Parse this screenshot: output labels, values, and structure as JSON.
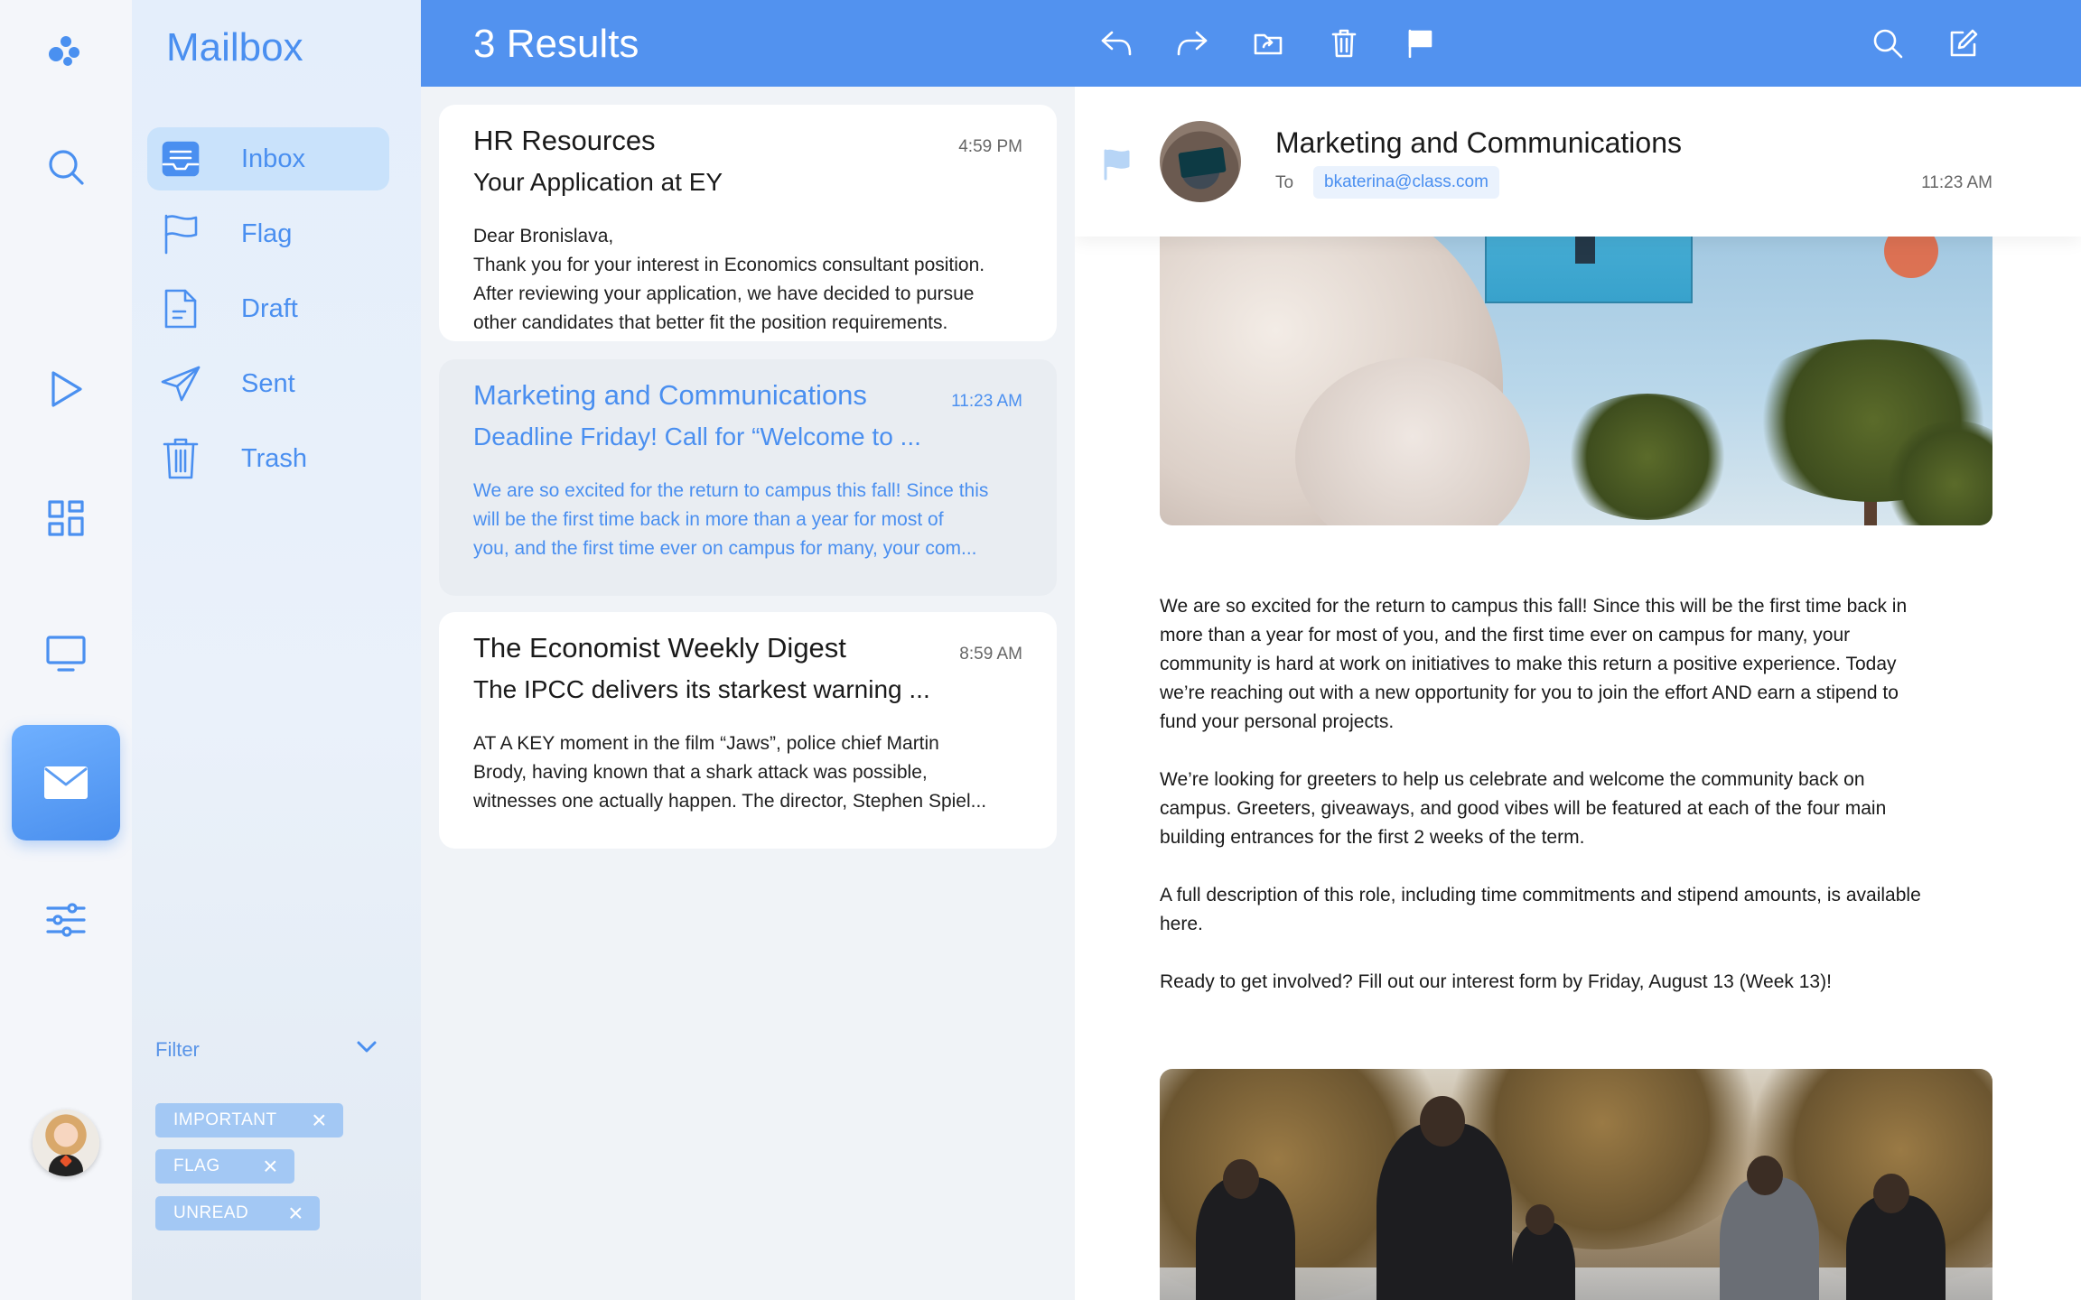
{
  "rail": {
    "icons": [
      "logo-icon",
      "search-icon",
      "play-icon",
      "dashboard-icon",
      "monitor-icon",
      "mail-icon",
      "settings-sliders-icon"
    ],
    "active": "mail-icon"
  },
  "sidebar": {
    "title": "Mailbox",
    "items": [
      {
        "label": "Inbox",
        "icon": "inbox-icon",
        "active": true
      },
      {
        "label": "Flag",
        "icon": "flag-icon"
      },
      {
        "label": "Draft",
        "icon": "draft-icon"
      },
      {
        "label": "Sent",
        "icon": "sent-icon"
      },
      {
        "label": "Trash",
        "icon": "trash-icon"
      }
    ],
    "filter_label": "Filter",
    "filters": [
      "IMPORTANT",
      "FLAG",
      "UNREAD"
    ]
  },
  "header": {
    "results": "3 Results",
    "actions": [
      "reply-icon",
      "forward-icon",
      "move-folder-icon",
      "delete-icon",
      "flag-icon",
      "search-icon",
      "compose-icon"
    ]
  },
  "messages": [
    {
      "sender": "HR Resources",
      "time": "4:59 PM",
      "subject": "Your Application at EY",
      "preview_lines": [
        "Dear Bronislava,",
        "Thank you for your interest in Economics consultant position.",
        "After reviewing your application, we have decided to pursue",
        "other candidates that better fit the position requirements."
      ]
    },
    {
      "sender": "Marketing and Communications",
      "time": "11:23 AM",
      "subject": "Deadline Friday! Call for “Welcome to ...",
      "preview_lines": [
        "We are so excited for the return to campus this fall! Since this",
        "will be the first time back in more than a year for most of",
        "you, and the first time ever on campus for many, your com..."
      ],
      "selected": true
    },
    {
      "sender": "The Economist Weekly Digest",
      "time": "8:59 AM",
      "subject": "The IPCC delivers its starkest warning ...",
      "preview_lines": [
        "AT A KEY moment in the film “Jaws”, police chief Martin",
        "Brody, having known that a shark attack was possible,",
        "witnesses one actually happen. The director, Stephen Spiel..."
      ]
    }
  ],
  "reader": {
    "sender": "Marketing and Communications",
    "to_label": "To",
    "to_address": "bkaterina@class.com",
    "time": "11:23 AM",
    "paragraphs": [
      [
        "We are so excited for the return to campus this fall! Since this will be the first time back in",
        "more than a year for most of you, and the first time ever on campus for many, your",
        "community is hard at work on initiatives to make this return a positive experience. Today",
        "we’re reaching out with a new opportunity for you to join the effort AND earn a stipend to",
        "fund your personal projects."
      ],
      [
        "We’re looking for greeters to help us celebrate and welcome the community back on",
        "campus. Greeters, giveaways, and good vibes will be featured at each of the four main",
        "building entrances for the first 2 weeks of the term."
      ],
      [
        "A full description of this role, including time commitments and stipend amounts, is available",
        "here."
      ],
      [
        "Ready to get involved? Fill out our interest form by Friday, August 13 (Week 13)!"
      ]
    ]
  },
  "colors": {
    "accent": "#4a8ff0",
    "header": "#5292ef",
    "selected_card": "#e9edf2",
    "chip": "#a3c8f4"
  }
}
